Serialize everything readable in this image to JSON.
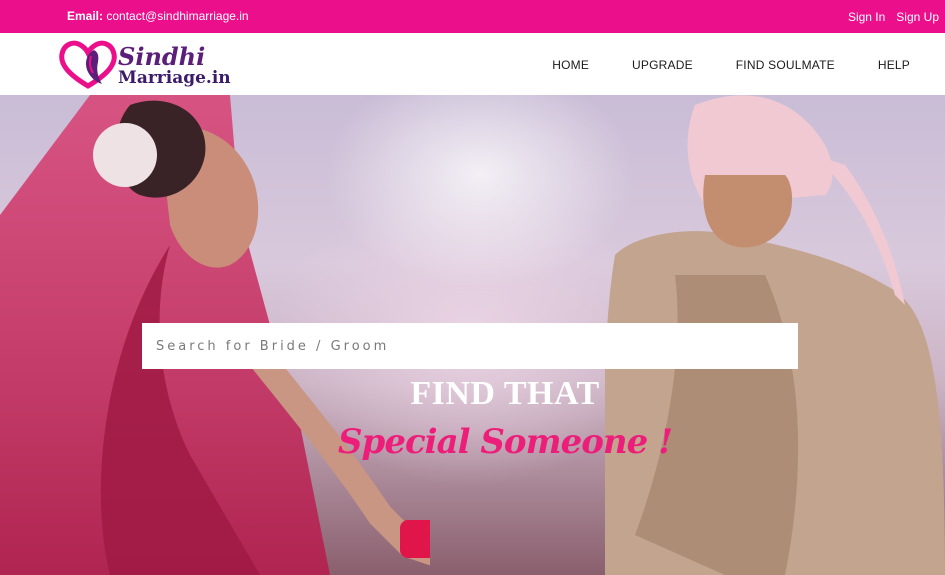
{
  "topbar": {
    "email_label": "Email:",
    "email_value": "contact@sindhimarriage.in",
    "sign_in": "Sign In",
    "sign_up": "Sign Up"
  },
  "logo": {
    "line1": "Sindhi",
    "line2": "Marriage.in"
  },
  "nav": {
    "home": "HOME",
    "upgrade": "UPGRADE",
    "find_soulmate": "FIND SOULMATE",
    "help": "HELP"
  },
  "hero": {
    "search_placeholder": "Search for Bride / Groom",
    "headline": "FIND THAT",
    "tagline": "Special Someone !"
  },
  "colors": {
    "brand_pink": "#ec0f8c",
    "tagline_pink": "#ec1e79",
    "logo_purple": "#5b1f7a"
  }
}
